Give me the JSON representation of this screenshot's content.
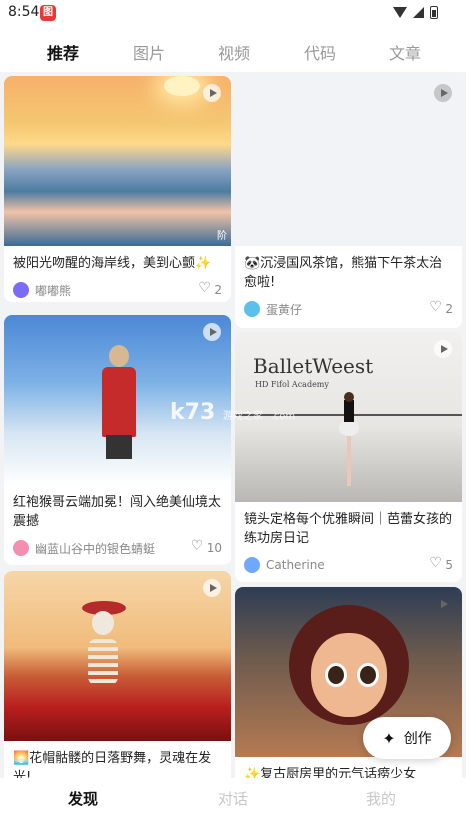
{
  "status": {
    "time": "8:54",
    "app_badge": "图"
  },
  "tabs": [
    {
      "label": "推荐"
    },
    {
      "label": "图片"
    },
    {
      "label": "视频"
    },
    {
      "label": "代码"
    },
    {
      "label": "文章"
    }
  ],
  "active_tab": "推荐",
  "cards": [
    {
      "title": "被阳光吻醒的海岸线，美到心颤✨",
      "author": "嘟嘟熊",
      "likes": "2",
      "avatar_color": "#7b6cf6",
      "corner_mark": "阶"
    },
    {
      "title": "🐼沉浸国风茶馆，熊猫下午茶太治愈啦!",
      "author": "蛋黄仔",
      "likes": "2",
      "avatar_color": "#5bc0eb"
    },
    {
      "title": "红袍猴哥云端加冕！闯入绝美仙境太震撼",
      "author": "幽蓝山谷中的银色蜻蜓",
      "likes": "10",
      "avatar_color": "#f48fb1"
    },
    {
      "title": "镜头定格每个优雅瞬间｜芭蕾女孩的练功房日记",
      "author": "Catherine",
      "likes": "5",
      "avatar_color": "#6fa8ff",
      "image_text": {
        "line1": "BalletWeest",
        "line2": "HD Fifol Academy"
      }
    },
    {
      "title": "🌅花帽骷髅的日落野舞，灵魂在发光!",
      "author": "",
      "likes": ""
    },
    {
      "title": "✨复古厨房里的元气话痨少女",
      "author": "",
      "likes": ""
    }
  ],
  "watermark": {
    "brand": "k73",
    "sub": "游戏之家",
    "domain": ".com"
  },
  "create_button": {
    "label": "创作"
  },
  "bottom_nav": [
    {
      "label": "发现"
    },
    {
      "label": "对话"
    },
    {
      "label": "我的"
    }
  ],
  "colors": {
    "background": "#f2f3f5",
    "active_text": "#111111",
    "inactive_text": "#999999"
  }
}
